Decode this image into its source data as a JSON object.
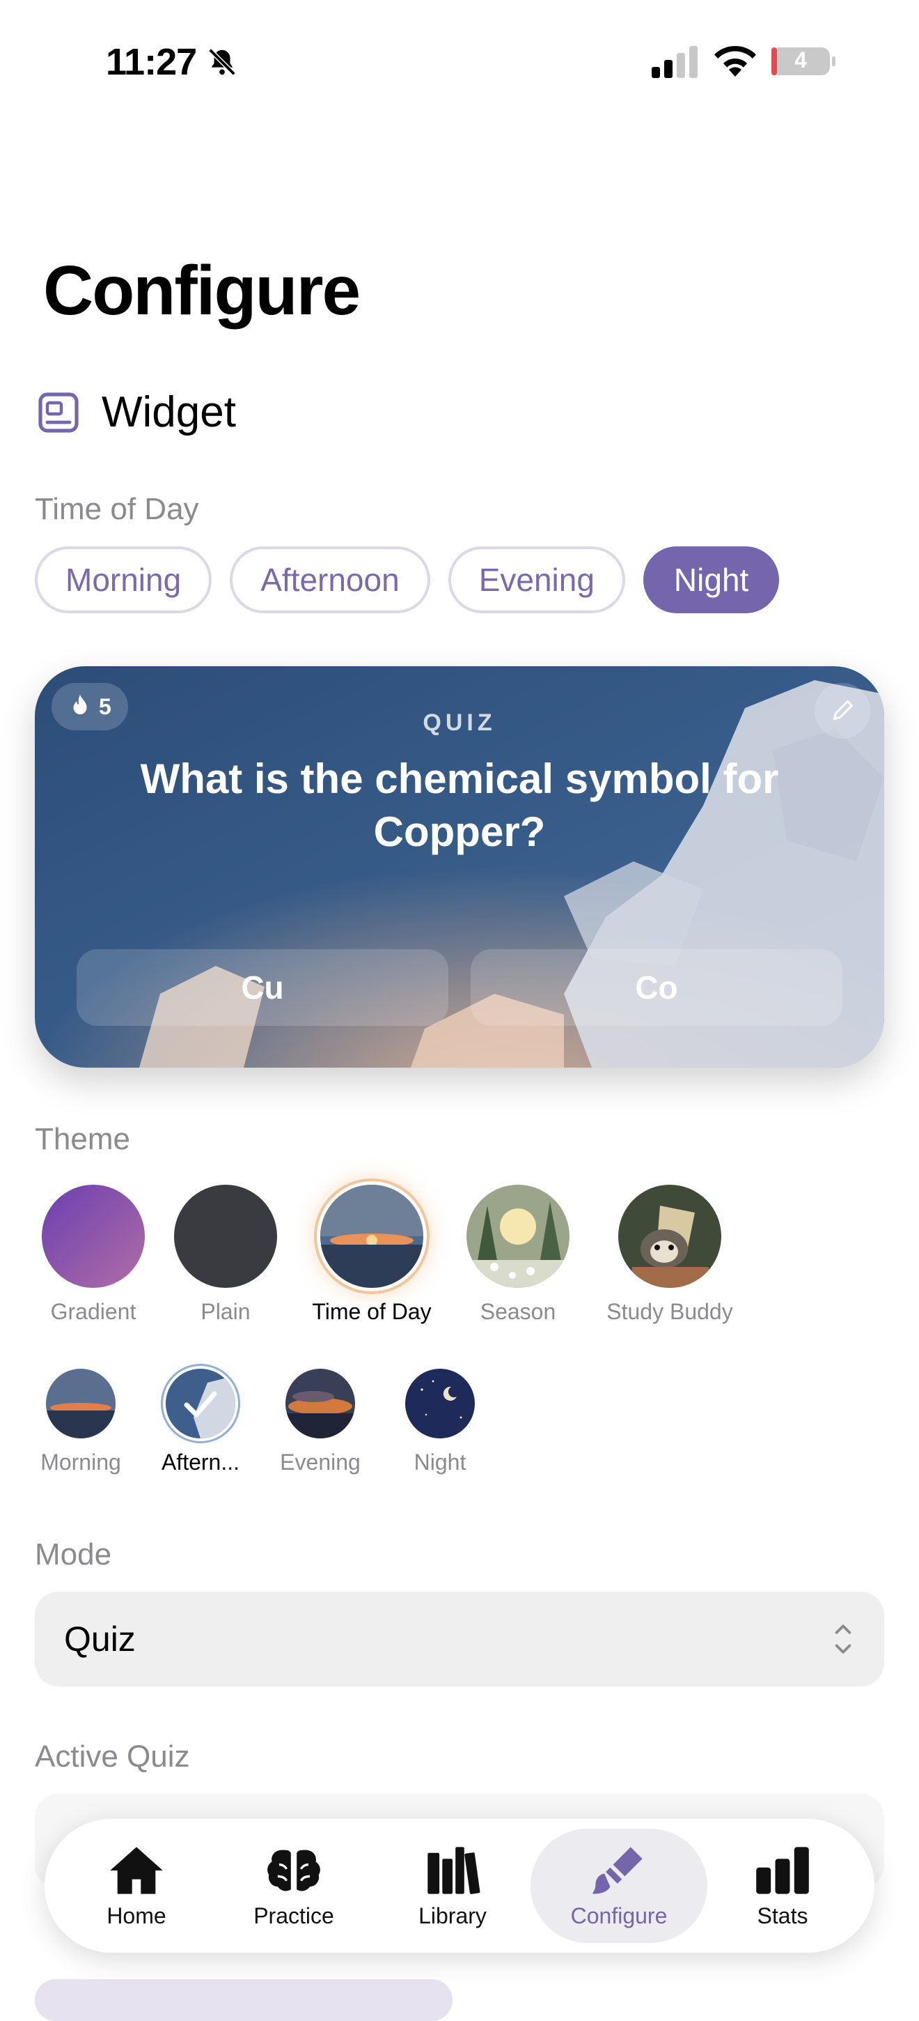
{
  "status_bar": {
    "time": "11:27",
    "battery": "4"
  },
  "page_title": "Configure",
  "widget_section": {
    "label": "Widget"
  },
  "time_of_day": {
    "label": "Time of Day",
    "options": [
      "Morning",
      "Afternoon",
      "Evening",
      "Night"
    ],
    "selected": "Night"
  },
  "preview": {
    "streak": "5",
    "kind": "QUIZ",
    "question": "What is the chemical symbol for Copper?",
    "answers": [
      "Cu",
      "Co"
    ]
  },
  "theme": {
    "label": "Theme",
    "styles": [
      "Gradient",
      "Plain",
      "Time of Day",
      "Season",
      "Study Buddy"
    ],
    "selected_style": "Time of Day",
    "variants": [
      "Morning",
      "Aftern...",
      "Evening",
      "Night"
    ],
    "selected_variant": "Aftern..."
  },
  "mode": {
    "label": "Mode",
    "value": "Quiz"
  },
  "active_quiz": {
    "label": "Active Quiz"
  },
  "tab_bar": {
    "items": [
      "Home",
      "Practice",
      "Library",
      "Configure",
      "Stats"
    ],
    "active": "Configure"
  },
  "colors": {
    "accent": "#7565ad",
    "pill_border": "#dcd8e6",
    "field_bg": "#efeff0"
  }
}
